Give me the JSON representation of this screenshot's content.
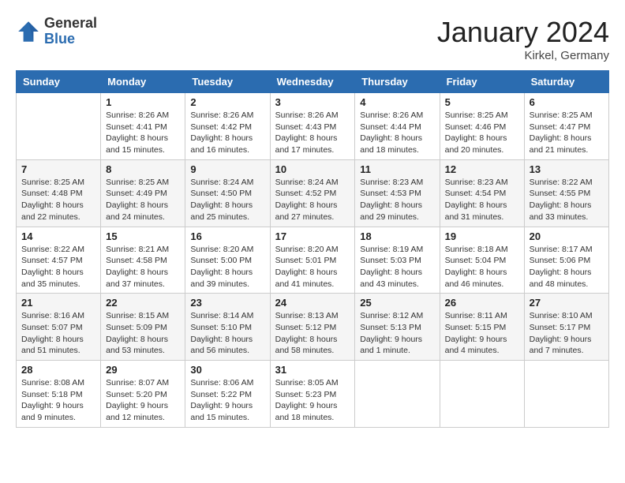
{
  "header": {
    "logo_general": "General",
    "logo_blue": "Blue",
    "month_title": "January 2024",
    "location": "Kirkel, Germany"
  },
  "weekdays": [
    "Sunday",
    "Monday",
    "Tuesday",
    "Wednesday",
    "Thursday",
    "Friday",
    "Saturday"
  ],
  "weeks": [
    [
      {
        "day": "",
        "sunrise": "",
        "sunset": "",
        "daylight": ""
      },
      {
        "day": "1",
        "sunrise": "Sunrise: 8:26 AM",
        "sunset": "Sunset: 4:41 PM",
        "daylight": "Daylight: 8 hours and 15 minutes."
      },
      {
        "day": "2",
        "sunrise": "Sunrise: 8:26 AM",
        "sunset": "Sunset: 4:42 PM",
        "daylight": "Daylight: 8 hours and 16 minutes."
      },
      {
        "day": "3",
        "sunrise": "Sunrise: 8:26 AM",
        "sunset": "Sunset: 4:43 PM",
        "daylight": "Daylight: 8 hours and 17 minutes."
      },
      {
        "day": "4",
        "sunrise": "Sunrise: 8:26 AM",
        "sunset": "Sunset: 4:44 PM",
        "daylight": "Daylight: 8 hours and 18 minutes."
      },
      {
        "day": "5",
        "sunrise": "Sunrise: 8:25 AM",
        "sunset": "Sunset: 4:46 PM",
        "daylight": "Daylight: 8 hours and 20 minutes."
      },
      {
        "day": "6",
        "sunrise": "Sunrise: 8:25 AM",
        "sunset": "Sunset: 4:47 PM",
        "daylight": "Daylight: 8 hours and 21 minutes."
      }
    ],
    [
      {
        "day": "7",
        "sunrise": "Sunrise: 8:25 AM",
        "sunset": "Sunset: 4:48 PM",
        "daylight": "Daylight: 8 hours and 22 minutes."
      },
      {
        "day": "8",
        "sunrise": "Sunrise: 8:25 AM",
        "sunset": "Sunset: 4:49 PM",
        "daylight": "Daylight: 8 hours and 24 minutes."
      },
      {
        "day": "9",
        "sunrise": "Sunrise: 8:24 AM",
        "sunset": "Sunset: 4:50 PM",
        "daylight": "Daylight: 8 hours and 25 minutes."
      },
      {
        "day": "10",
        "sunrise": "Sunrise: 8:24 AM",
        "sunset": "Sunset: 4:52 PM",
        "daylight": "Daylight: 8 hours and 27 minutes."
      },
      {
        "day": "11",
        "sunrise": "Sunrise: 8:23 AM",
        "sunset": "Sunset: 4:53 PM",
        "daylight": "Daylight: 8 hours and 29 minutes."
      },
      {
        "day": "12",
        "sunrise": "Sunrise: 8:23 AM",
        "sunset": "Sunset: 4:54 PM",
        "daylight": "Daylight: 8 hours and 31 minutes."
      },
      {
        "day": "13",
        "sunrise": "Sunrise: 8:22 AM",
        "sunset": "Sunset: 4:55 PM",
        "daylight": "Daylight: 8 hours and 33 minutes."
      }
    ],
    [
      {
        "day": "14",
        "sunrise": "Sunrise: 8:22 AM",
        "sunset": "Sunset: 4:57 PM",
        "daylight": "Daylight: 8 hours and 35 minutes."
      },
      {
        "day": "15",
        "sunrise": "Sunrise: 8:21 AM",
        "sunset": "Sunset: 4:58 PM",
        "daylight": "Daylight: 8 hours and 37 minutes."
      },
      {
        "day": "16",
        "sunrise": "Sunrise: 8:20 AM",
        "sunset": "Sunset: 5:00 PM",
        "daylight": "Daylight: 8 hours and 39 minutes."
      },
      {
        "day": "17",
        "sunrise": "Sunrise: 8:20 AM",
        "sunset": "Sunset: 5:01 PM",
        "daylight": "Daylight: 8 hours and 41 minutes."
      },
      {
        "day": "18",
        "sunrise": "Sunrise: 8:19 AM",
        "sunset": "Sunset: 5:03 PM",
        "daylight": "Daylight: 8 hours and 43 minutes."
      },
      {
        "day": "19",
        "sunrise": "Sunrise: 8:18 AM",
        "sunset": "Sunset: 5:04 PM",
        "daylight": "Daylight: 8 hours and 46 minutes."
      },
      {
        "day": "20",
        "sunrise": "Sunrise: 8:17 AM",
        "sunset": "Sunset: 5:06 PM",
        "daylight": "Daylight: 8 hours and 48 minutes."
      }
    ],
    [
      {
        "day": "21",
        "sunrise": "Sunrise: 8:16 AM",
        "sunset": "Sunset: 5:07 PM",
        "daylight": "Daylight: 8 hours and 51 minutes."
      },
      {
        "day": "22",
        "sunrise": "Sunrise: 8:15 AM",
        "sunset": "Sunset: 5:09 PM",
        "daylight": "Daylight: 8 hours and 53 minutes."
      },
      {
        "day": "23",
        "sunrise": "Sunrise: 8:14 AM",
        "sunset": "Sunset: 5:10 PM",
        "daylight": "Daylight: 8 hours and 56 minutes."
      },
      {
        "day": "24",
        "sunrise": "Sunrise: 8:13 AM",
        "sunset": "Sunset: 5:12 PM",
        "daylight": "Daylight: 8 hours and 58 minutes."
      },
      {
        "day": "25",
        "sunrise": "Sunrise: 8:12 AM",
        "sunset": "Sunset: 5:13 PM",
        "daylight": "Daylight: 9 hours and 1 minute."
      },
      {
        "day": "26",
        "sunrise": "Sunrise: 8:11 AM",
        "sunset": "Sunset: 5:15 PM",
        "daylight": "Daylight: 9 hours and 4 minutes."
      },
      {
        "day": "27",
        "sunrise": "Sunrise: 8:10 AM",
        "sunset": "Sunset: 5:17 PM",
        "daylight": "Daylight: 9 hours and 7 minutes."
      }
    ],
    [
      {
        "day": "28",
        "sunrise": "Sunrise: 8:08 AM",
        "sunset": "Sunset: 5:18 PM",
        "daylight": "Daylight: 9 hours and 9 minutes."
      },
      {
        "day": "29",
        "sunrise": "Sunrise: 8:07 AM",
        "sunset": "Sunset: 5:20 PM",
        "daylight": "Daylight: 9 hours and 12 minutes."
      },
      {
        "day": "30",
        "sunrise": "Sunrise: 8:06 AM",
        "sunset": "Sunset: 5:22 PM",
        "daylight": "Daylight: 9 hours and 15 minutes."
      },
      {
        "day": "31",
        "sunrise": "Sunrise: 8:05 AM",
        "sunset": "Sunset: 5:23 PM",
        "daylight": "Daylight: 9 hours and 18 minutes."
      },
      {
        "day": "",
        "sunrise": "",
        "sunset": "",
        "daylight": ""
      },
      {
        "day": "",
        "sunrise": "",
        "sunset": "",
        "daylight": ""
      },
      {
        "day": "",
        "sunrise": "",
        "sunset": "",
        "daylight": ""
      }
    ]
  ]
}
